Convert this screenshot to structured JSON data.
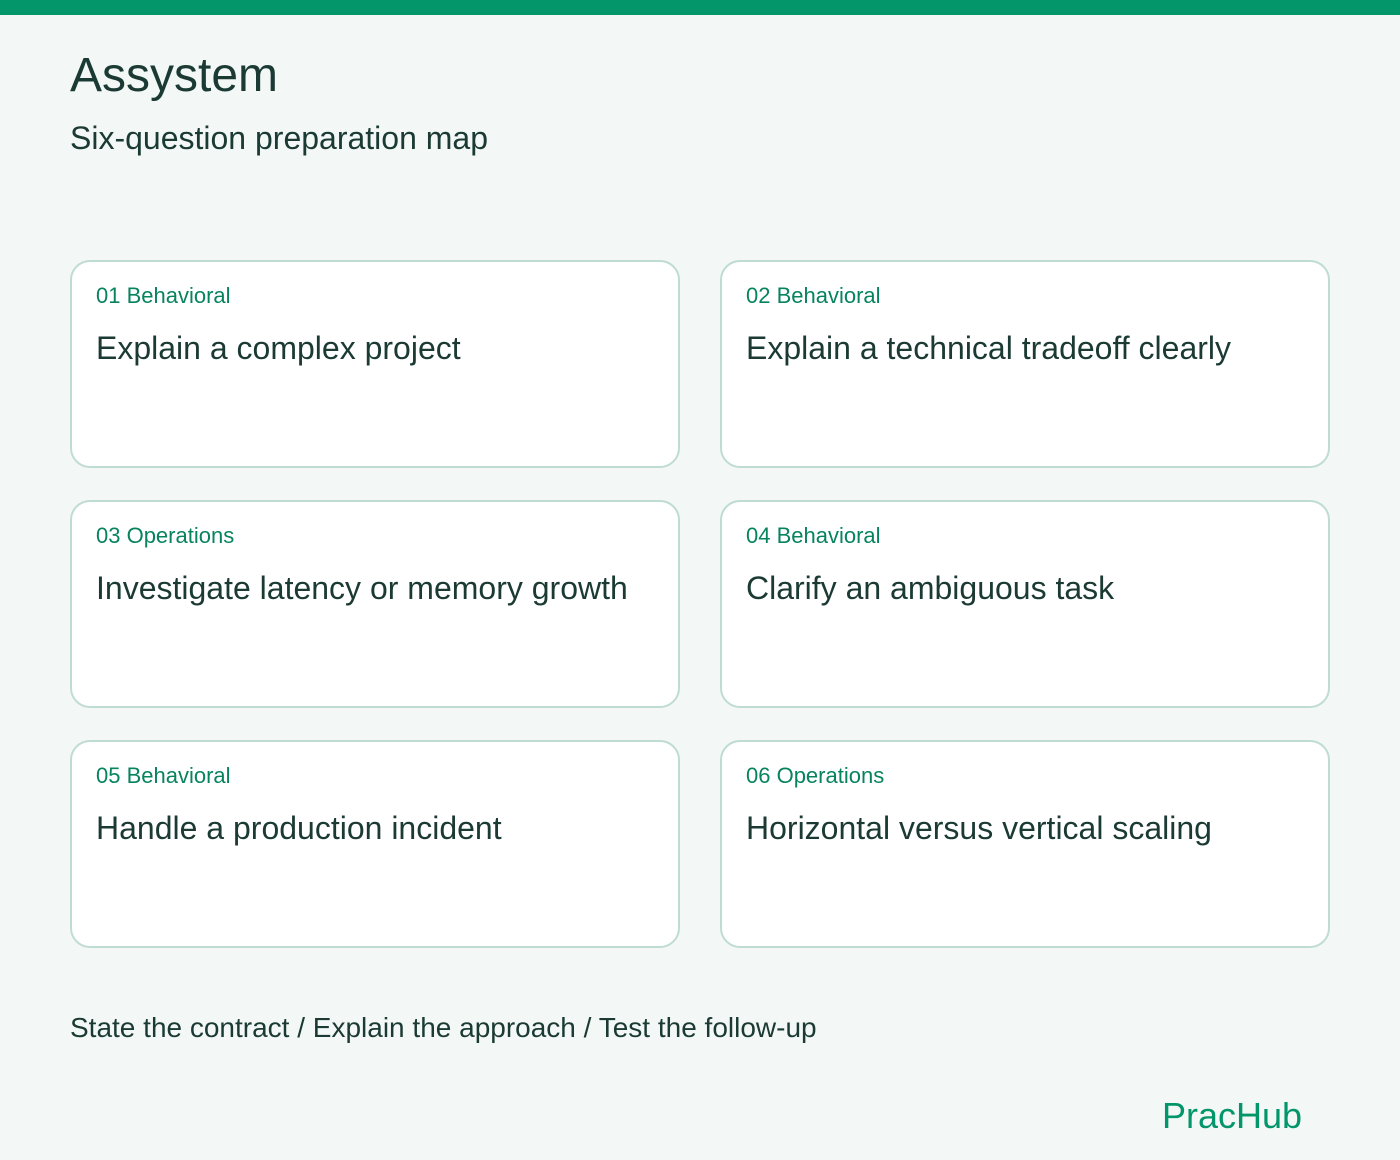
{
  "header": {
    "title": "Assystem",
    "subtitle": "Six-question preparation map"
  },
  "cards": [
    {
      "tag": "01 Behavioral",
      "title": "Explain a complex project"
    },
    {
      "tag": "02 Behavioral",
      "title": "Explain a technical tradeoff clearly"
    },
    {
      "tag": "03 Operations",
      "title": "Investigate latency or memory growth"
    },
    {
      "tag": "04 Behavioral",
      "title": "Clarify an ambiguous task"
    },
    {
      "tag": "05 Behavioral",
      "title": "Handle a production incident"
    },
    {
      "tag": "06 Operations",
      "title": "Horizontal versus vertical scaling"
    }
  ],
  "footer": {
    "note": "State the contract / Explain the approach / Test the follow-up",
    "brand": "PracHub"
  },
  "colors": {
    "accent": "#03966a",
    "background": "#f3f8f6",
    "card_border": "#bfdcd2",
    "text": "#1b3a33",
    "tag_text": "#07845d"
  }
}
